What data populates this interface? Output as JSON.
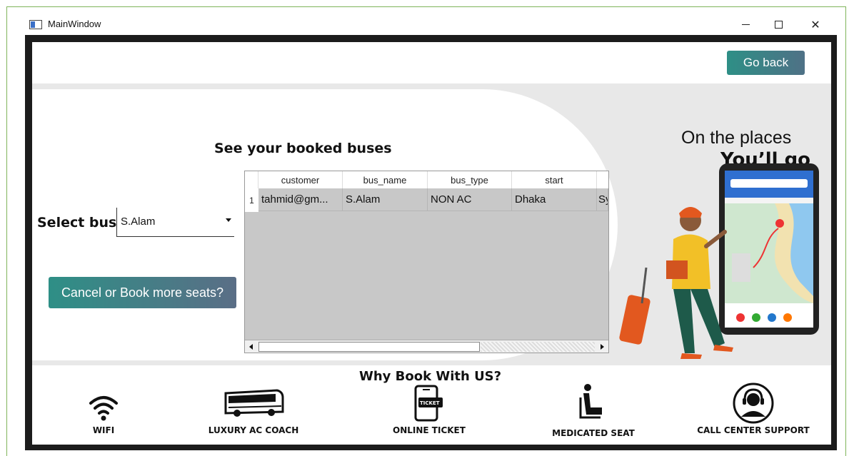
{
  "window": {
    "title": "MainWindow",
    "minimize_icon": "minimize-icon",
    "maximize_icon": "maximize-icon",
    "close_glyph": "✕"
  },
  "header": {
    "go_back_label": "Go back"
  },
  "booking": {
    "title": "See your booked buses",
    "select_label": "Select bus",
    "selected_bus": "S.Alam",
    "cancel_button_label": "Cancel or Book more seats?"
  },
  "table": {
    "columns": [
      "customer",
      "bus_name",
      "bus_type",
      "start"
    ],
    "rows": [
      {
        "num": "1",
        "cells": [
          "tahmid@gm...",
          "S.Alam",
          "NON AC",
          "Dhaka",
          "Sy"
        ]
      }
    ]
  },
  "promo": {
    "line1": "On the places",
    "line2": "You’ll go"
  },
  "features": {
    "title": "Why Book With US?",
    "items": [
      {
        "label": "WIFI",
        "icon": "wifi-icon"
      },
      {
        "label": "LUXURY AC COACH",
        "icon": "bus-icon"
      },
      {
        "label": "ONLINE TICKET",
        "icon": "ticket-phone-icon"
      },
      {
        "label": "MEDICATED SEAT",
        "icon": "seat-icon"
      },
      {
        "label": "CALL CENTER SUPPORT",
        "icon": "headset-icon"
      }
    ]
  },
  "colors": {
    "accent_teal": "#2e8f86",
    "frame_green": "#7fb45a",
    "window_dark": "#1c1c1c"
  }
}
